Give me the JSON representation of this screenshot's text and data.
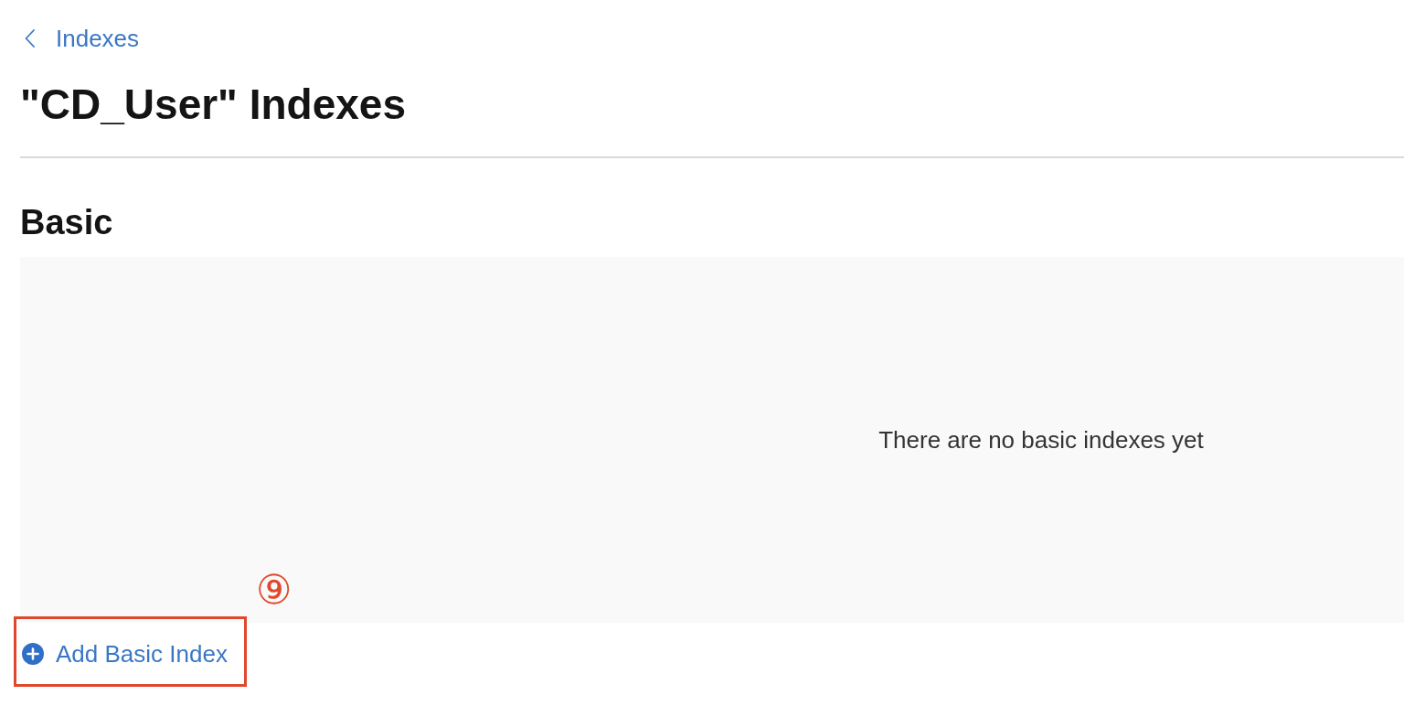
{
  "back_link": {
    "label": "Indexes"
  },
  "title": "\"CD_User\" Indexes",
  "sections": [
    {
      "heading": "Basic",
      "empty_message": "There are no basic indexes yet",
      "add_button": {
        "label": "Add Basic Index",
        "highlighted": true
      }
    }
  ],
  "annotation": {
    "marker": "⑨"
  }
}
